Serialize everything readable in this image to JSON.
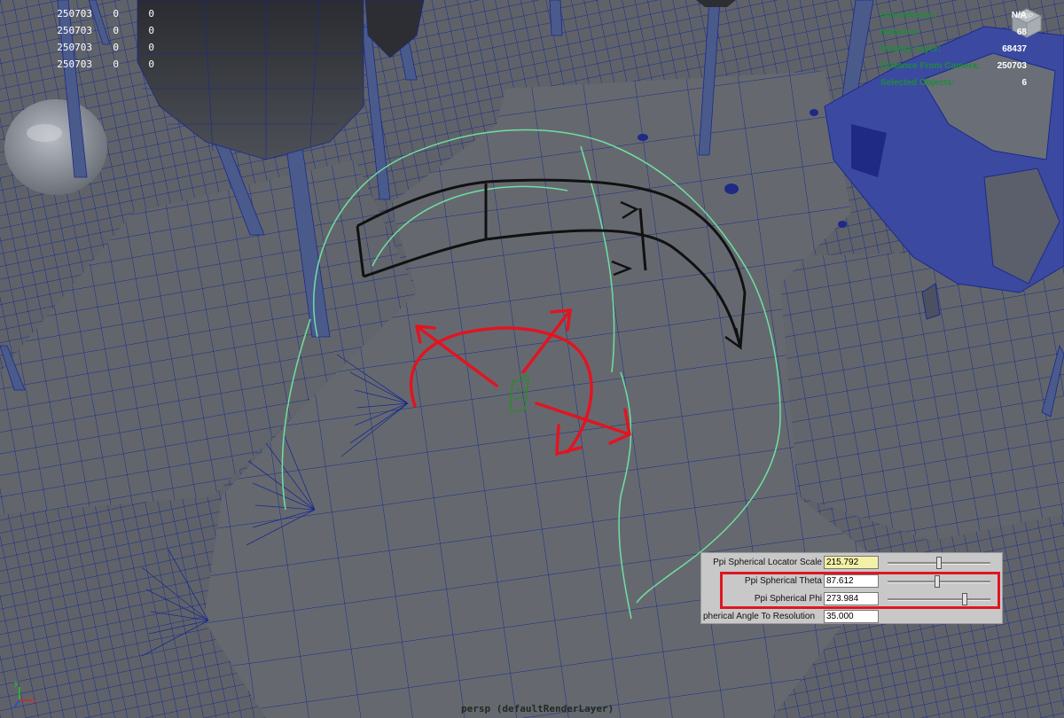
{
  "hud_left": {
    "rows": [
      {
        "label": "",
        "value": "250703",
        "c1": "0",
        "c2": "0"
      },
      {
        "label": "",
        "value": "250703",
        "c1": "0",
        "c2": "0"
      },
      {
        "label": "",
        "value": "250703",
        "c1": "0",
        "c2": "0"
      },
      {
        "label": "",
        "value": "250703",
        "c1": "0",
        "c2": "0"
      }
    ]
  },
  "hud_right": {
    "rows": [
      {
        "label": "Smoothness:",
        "value": "N/A"
      },
      {
        "label": "Instance:",
        "value": "68"
      },
      {
        "label": "Display Layer:",
        "value": "68437"
      },
      {
        "label": "Distance From Camera:",
        "value": "250703"
      },
      {
        "label": "Selected Objects:",
        "value": "6"
      }
    ]
  },
  "view_cube": {
    "label": "TOP"
  },
  "camera_label": "persp (defaultRenderLayer)",
  "attributes": {
    "rows": [
      {
        "label": "Ppi Spherical Locator Scale",
        "value": "215.792",
        "slider_pct": 50
      },
      {
        "label": "Ppi Spherical Theta",
        "value": "87.612",
        "slider_pct": 48
      },
      {
        "label": "Ppi Spherical Phi",
        "value": "273.984",
        "slider_pct": 76
      },
      {
        "label": "pherical Angle To Resolution",
        "value": "35.000",
        "slider_pct": null
      }
    ]
  },
  "colors": {
    "background": "#5f6369",
    "wire": "#1a2a8c",
    "curve": "#6fe0a0",
    "gizmo_red": "#e01522",
    "gizmo_black": "#111111",
    "hud_green": "#1f8a3c"
  }
}
